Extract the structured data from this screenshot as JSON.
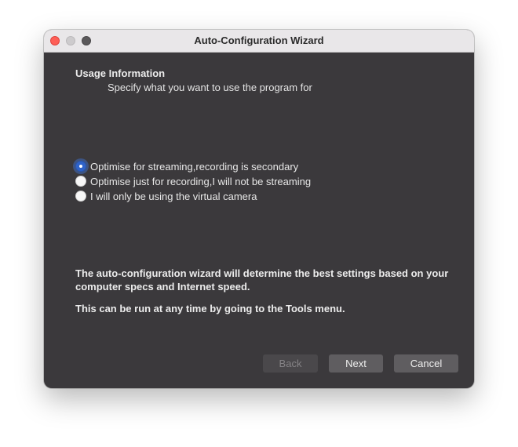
{
  "window": {
    "title": "Auto-Configuration Wizard"
  },
  "page": {
    "heading": "Usage Information",
    "subheading": "Specify what you want to use the program for"
  },
  "usage_options": {
    "selected": 0,
    "items": [
      {
        "label": "Optimise for streaming,recording is secondary",
        "checked": true
      },
      {
        "label": "Optimise just for recording,I will not be streaming",
        "checked": false
      },
      {
        "label": "I will only be using the virtual camera",
        "checked": false
      }
    ]
  },
  "info": {
    "line1": "The auto-configuration wizard will determine the best settings based on your computer specs and Internet speed.",
    "line2": "This can be run at any time by going to the Tools menu."
  },
  "buttons": {
    "back": "Back",
    "next": "Next",
    "cancel": "Cancel"
  },
  "colors": {
    "window_background": "#3b393c",
    "titlebar": "#e9e7e9",
    "accent": "#2f63c9",
    "close": "#fe5f57"
  }
}
